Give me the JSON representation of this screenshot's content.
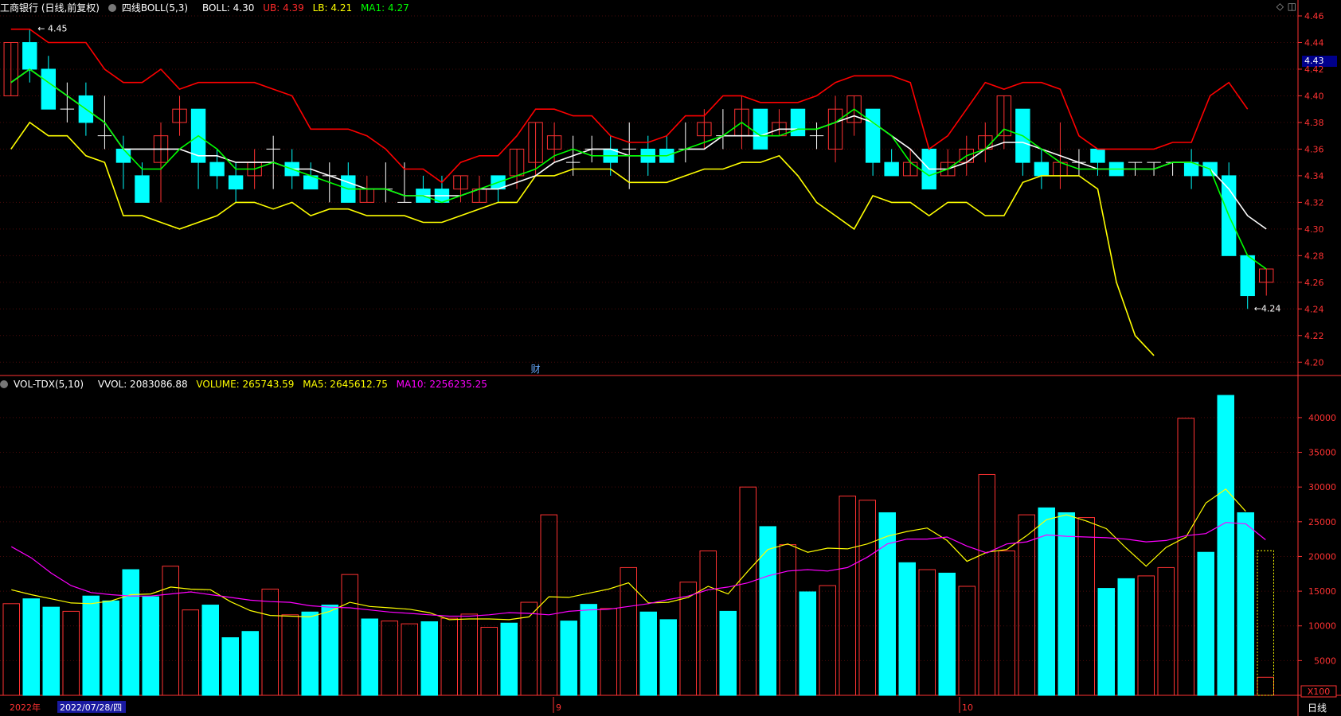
{
  "title": "工商银行 (日线,前复权)",
  "boll": {
    "name": "四线BOLL(5,3)",
    "items": [
      {
        "label": "BOLL: 4.30",
        "color": "#ffffff"
      },
      {
        "label": "UB: 4.39",
        "color": "#ff2a2a"
      },
      {
        "label": "LB: 4.21",
        "color": "#ffff00"
      },
      {
        "label": "MA1: 4.27",
        "color": "#00ff00"
      }
    ]
  },
  "vol": {
    "name": "VOL-TDX(5,10)",
    "items": [
      {
        "label": "VVOL: 2083086.88",
        "color": "#ffffff"
      },
      {
        "label": "VOLUME: 265743.59",
        "color": "#ffff00"
      },
      {
        "label": "MA5: 2645612.75",
        "color": "#ffff00"
      },
      {
        "label": "MA10: 2256235.25",
        "color": "#ff00ff"
      }
    ]
  },
  "current_price": "4.43",
  "marker_fin": "财",
  "max_label": "4.45",
  "min_label": "4.24",
  "vol_unit": "X100",
  "period_label": "日线",
  "dates": {
    "year": "2022年",
    "cursor": "2022/07/28/四",
    "m9": "9",
    "m10": "10"
  },
  "colors": {
    "up": "#ff3232",
    "down": "#00ffff",
    "ub": "#ff0000",
    "lb": "#ffff00",
    "mid": "#ffffff",
    "ma1": "#00ff00",
    "vma5": "#ffff00",
    "vma10": "#ff00ff",
    "axis": "#ff3232"
  },
  "chart_data": [
    {
      "type": "candlestick",
      "ylim": [
        4.19,
        4.46
      ],
      "y_ticks": [
        "4.20",
        "4.22",
        "4.24",
        "4.26",
        "4.28",
        "4.30",
        "4.32",
        "4.34",
        "4.36",
        "4.38",
        "4.40",
        "4.42",
        "4.44",
        "4.46"
      ],
      "candles": [
        {
          "o": 4.4,
          "c": 4.44,
          "h": 4.44,
          "l": 4.4
        },
        {
          "o": 4.44,
          "c": 4.42,
          "h": 4.45,
          "l": 4.41
        },
        {
          "o": 4.42,
          "c": 4.39,
          "h": 4.43,
          "l": 4.39
        },
        {
          "o": 4.39,
          "c": 4.39,
          "h": 4.41,
          "l": 4.38
        },
        {
          "o": 4.4,
          "c": 4.38,
          "h": 4.41,
          "l": 4.37
        },
        {
          "o": 4.37,
          "c": 4.37,
          "h": 4.4,
          "l": 4.36
        },
        {
          "o": 4.36,
          "c": 4.35,
          "h": 4.37,
          "l": 4.33
        },
        {
          "o": 4.34,
          "c": 4.32,
          "h": 4.35,
          "l": 4.32
        },
        {
          "o": 4.35,
          "c": 4.37,
          "h": 4.38,
          "l": 4.32
        },
        {
          "o": 4.38,
          "c": 4.39,
          "h": 4.4,
          "l": 4.37
        },
        {
          "o": 4.39,
          "c": 4.35,
          "h": 4.39,
          "l": 4.33
        },
        {
          "o": 4.35,
          "c": 4.34,
          "h": 4.36,
          "l": 4.33
        },
        {
          "o": 4.34,
          "c": 4.33,
          "h": 4.35,
          "l": 4.32
        },
        {
          "o": 4.34,
          "c": 4.35,
          "h": 4.36,
          "l": 4.33
        },
        {
          "o": 4.36,
          "c": 4.36,
          "h": 4.37,
          "l": 4.33
        },
        {
          "o": 4.35,
          "c": 4.34,
          "h": 4.36,
          "l": 4.33
        },
        {
          "o": 4.34,
          "c": 4.33,
          "h": 4.35,
          "l": 4.33
        },
        {
          "o": 4.34,
          "c": 4.34,
          "h": 4.35,
          "l": 4.32
        },
        {
          "o": 4.34,
          "c": 4.32,
          "h": 4.35,
          "l": 4.32
        },
        {
          "o": 4.32,
          "c": 4.33,
          "h": 4.34,
          "l": 4.32
        },
        {
          "o": 4.33,
          "c": 4.33,
          "h": 4.35,
          "l": 4.32
        },
        {
          "o": 4.32,
          "c": 4.32,
          "h": 4.35,
          "l": 4.32
        },
        {
          "o": 4.33,
          "c": 4.32,
          "h": 4.34,
          "l": 4.32
        },
        {
          "o": 4.33,
          "c": 4.32,
          "h": 4.34,
          "l": 4.32
        },
        {
          "o": 4.33,
          "c": 4.34,
          "h": 4.34,
          "l": 4.32
        },
        {
          "o": 4.32,
          "c": 4.33,
          "h": 4.34,
          "l": 4.32
        },
        {
          "o": 4.34,
          "c": 4.33,
          "h": 4.34,
          "l": 4.32
        },
        {
          "o": 4.34,
          "c": 4.36,
          "h": 4.36,
          "l": 4.33
        },
        {
          "o": 4.35,
          "c": 4.38,
          "h": 4.38,
          "l": 4.34
        },
        {
          "o": 4.36,
          "c": 4.37,
          "h": 4.38,
          "l": 4.35
        },
        {
          "o": 4.35,
          "c": 4.35,
          "h": 4.37,
          "l": 4.34
        },
        {
          "o": 4.36,
          "c": 4.36,
          "h": 4.37,
          "l": 4.35
        },
        {
          "o": 4.36,
          "c": 4.35,
          "h": 4.37,
          "l": 4.34
        },
        {
          "o": 4.36,
          "c": 4.36,
          "h": 4.38,
          "l": 4.33
        },
        {
          "o": 4.36,
          "c": 4.35,
          "h": 4.37,
          "l": 4.34
        },
        {
          "o": 4.36,
          "c": 4.35,
          "h": 4.37,
          "l": 4.35
        },
        {
          "o": 4.36,
          "c": 4.36,
          "h": 4.38,
          "l": 4.35
        },
        {
          "o": 4.37,
          "c": 4.38,
          "h": 4.39,
          "l": 4.36
        },
        {
          "o": 4.37,
          "c": 4.37,
          "h": 4.39,
          "l": 4.36
        },
        {
          "o": 4.37,
          "c": 4.39,
          "h": 4.4,
          "l": 4.36
        },
        {
          "o": 4.39,
          "c": 4.36,
          "h": 4.39,
          "l": 4.36
        },
        {
          "o": 4.37,
          "c": 4.38,
          "h": 4.39,
          "l": 4.37
        },
        {
          "o": 4.39,
          "c": 4.37,
          "h": 4.39,
          "l": 4.37
        },
        {
          "o": 4.37,
          "c": 4.37,
          "h": 4.38,
          "l": 4.36
        },
        {
          "o": 4.36,
          "c": 4.39,
          "h": 4.4,
          "l": 4.35
        },
        {
          "o": 4.38,
          "c": 4.4,
          "h": 4.4,
          "l": 4.37
        },
        {
          "o": 4.39,
          "c": 4.35,
          "h": 4.39,
          "l": 4.34
        },
        {
          "o": 4.35,
          "c": 4.34,
          "h": 4.36,
          "l": 4.34
        },
        {
          "o": 4.34,
          "c": 4.35,
          "h": 4.36,
          "l": 4.34
        },
        {
          "o": 4.36,
          "c": 4.33,
          "h": 4.36,
          "l": 4.33
        },
        {
          "o": 4.34,
          "c": 4.35,
          "h": 4.36,
          "l": 4.34
        },
        {
          "o": 4.35,
          "c": 4.36,
          "h": 4.37,
          "l": 4.34
        },
        {
          "o": 4.36,
          "c": 4.37,
          "h": 4.38,
          "l": 4.35
        },
        {
          "o": 4.37,
          "c": 4.4,
          "h": 4.4,
          "l": 4.36
        },
        {
          "o": 4.39,
          "c": 4.35,
          "h": 4.39,
          "l": 4.34
        },
        {
          "o": 4.35,
          "c": 4.34,
          "h": 4.36,
          "l": 4.33
        },
        {
          "o": 4.34,
          "c": 4.35,
          "h": 4.38,
          "l": 4.33
        },
        {
          "o": 4.35,
          "c": 4.35,
          "h": 4.36,
          "l": 4.34
        },
        {
          "o": 4.36,
          "c": 4.35,
          "h": 4.36,
          "l": 4.34
        },
        {
          "o": 4.35,
          "c": 4.34,
          "h": 4.35,
          "l": 4.34
        },
        {
          "o": 4.35,
          "c": 4.35,
          "h": 4.35,
          "l": 4.34
        },
        {
          "o": 4.35,
          "c": 4.35,
          "h": 4.35,
          "l": 4.34
        },
        {
          "o": 4.35,
          "c": 4.35,
          "h": 4.35,
          "l": 4.34
        },
        {
          "o": 4.35,
          "c": 4.34,
          "h": 4.36,
          "l": 4.33
        },
        {
          "o": 4.35,
          "c": 4.34,
          "h": 4.35,
          "l": 4.34
        },
        {
          "o": 4.34,
          "c": 4.28,
          "h": 4.35,
          "l": 4.28
        },
        {
          "o": 4.28,
          "c": 4.25,
          "h": 4.28,
          "l": 4.24
        },
        {
          "o": 4.26,
          "c": 4.27,
          "h": 4.27,
          "l": 4.25
        }
      ],
      "mid": [
        4.41,
        4.42,
        4.41,
        4.4,
        4.39,
        4.38,
        4.36,
        4.36,
        4.36,
        4.36,
        4.355,
        4.355,
        4.35,
        4.35,
        4.35,
        4.345,
        4.345,
        4.34,
        4.335,
        4.33,
        4.33,
        4.325,
        4.325,
        4.325,
        4.325,
        4.33,
        4.33,
        4.335,
        4.34,
        4.35,
        4.355,
        4.36,
        4.36,
        4.355,
        4.355,
        4.355,
        4.36,
        4.36,
        4.37,
        4.37,
        4.37,
        4.375,
        4.375,
        4.375,
        4.38,
        4.385,
        4.38,
        4.37,
        4.36,
        4.345,
        4.345,
        4.35,
        4.36,
        4.365,
        4.365,
        4.36,
        4.355,
        4.35,
        4.345,
        4.345,
        4.345,
        4.345,
        4.35,
        4.35,
        4.345,
        4.33,
        4.31,
        4.3
      ],
      "ub": [
        4.45,
        4.45,
        4.44,
        4.44,
        4.44,
        4.42,
        4.41,
        4.41,
        4.42,
        4.405,
        4.41,
        4.41,
        4.41,
        4.41,
        4.405,
        4.4,
        4.375,
        4.375,
        4.375,
        4.37,
        4.36,
        4.345,
        4.345,
        4.335,
        4.35,
        4.355,
        4.355,
        4.37,
        4.39,
        4.39,
        4.385,
        4.385,
        4.37,
        4.365,
        4.365,
        4.37,
        4.385,
        4.385,
        4.4,
        4.4,
        4.395,
        4.395,
        4.395,
        4.4,
        4.41,
        4.415,
        4.415,
        4.415,
        4.41,
        4.36,
        4.37,
        4.39,
        4.41,
        4.405,
        4.41,
        4.41,
        4.405,
        4.37,
        4.36,
        4.36,
        4.36,
        4.36,
        4.365,
        4.365,
        4.4,
        4.41,
        4.39
      ],
      "lb": [
        4.36,
        4.38,
        4.37,
        4.37,
        4.355,
        4.35,
        4.31,
        4.31,
        4.305,
        4.3,
        4.305,
        4.31,
        4.32,
        4.32,
        4.315,
        4.32,
        4.31,
        4.315,
        4.315,
        4.31,
        4.31,
        4.31,
        4.305,
        4.305,
        4.31,
        4.315,
        4.32,
        4.32,
        4.34,
        4.34,
        4.345,
        4.345,
        4.345,
        4.335,
        4.335,
        4.335,
        4.34,
        4.345,
        4.345,
        4.35,
        4.35,
        4.355,
        4.34,
        4.32,
        4.31,
        4.3,
        4.325,
        4.32,
        4.32,
        4.31,
        4.32,
        4.32,
        4.31,
        4.31,
        4.335,
        4.34,
        4.34,
        4.34,
        4.33,
        4.26,
        4.22,
        4.205
      ],
      "ma1": [
        4.41,
        4.42,
        4.41,
        4.4,
        4.39,
        4.38,
        4.36,
        4.345,
        4.345,
        4.36,
        4.37,
        4.36,
        4.345,
        4.345,
        4.35,
        4.345,
        4.34,
        4.335,
        4.33,
        4.33,
        4.33,
        4.325,
        4.325,
        4.32,
        4.325,
        4.33,
        4.335,
        4.34,
        4.345,
        4.355,
        4.36,
        4.355,
        4.355,
        4.355,
        4.355,
        4.355,
        4.36,
        4.365,
        4.37,
        4.38,
        4.37,
        4.37,
        4.375,
        4.375,
        4.38,
        4.39,
        4.38,
        4.37,
        4.35,
        4.34,
        4.345,
        4.355,
        4.36,
        4.375,
        4.37,
        4.36,
        4.35,
        4.345,
        4.345,
        4.345,
        4.345,
        4.345,
        4.35,
        4.35,
        4.345,
        4.31,
        4.28,
        4.27
      ]
    },
    {
      "type": "bar",
      "ylim": [
        0,
        44000
      ],
      "y_ticks": [
        "5000",
        "10000",
        "15000",
        "20000",
        "25000",
        "30000",
        "35000",
        "40000"
      ],
      "values": [
        13200,
        13900,
        12700,
        12100,
        14300,
        13600,
        18100,
        14200,
        18600,
        12300,
        13000,
        8300,
        9200,
        15300,
        11600,
        12000,
        13000,
        17400,
        11000,
        10700,
        10300,
        10600,
        11100,
        11700,
        9800,
        10400,
        13400,
        26000,
        10700,
        13100,
        12500,
        18400,
        12000,
        10900,
        16300,
        20800,
        12100,
        30000,
        24300,
        21700,
        14900,
        15800,
        28700,
        28100,
        26300,
        19100,
        18100,
        17600,
        15700,
        31800,
        20800,
        26000,
        27000,
        26300,
        25600,
        15400,
        16800,
        17200,
        18400,
        39900,
        20600,
        43200,
        26300,
        2600
      ],
      "up": [
        1,
        0,
        0,
        1,
        0,
        0,
        0,
        0,
        1,
        1,
        0,
        0,
        0,
        1,
        1,
        0,
        0,
        1,
        0,
        1,
        1,
        0,
        1,
        1,
        1,
        0,
        1,
        1,
        0,
        0,
        1,
        1,
        0,
        0,
        1,
        1,
        0,
        1,
        0,
        1,
        0,
        1,
        1,
        1,
        0,
        0,
        1,
        0,
        1,
        1,
        1,
        1,
        0,
        0,
        1,
        0,
        0,
        1,
        1,
        1,
        0,
        0,
        0,
        1
      ],
      "ma5": [
        15200,
        14500,
        13900,
        13300,
        13200,
        13600,
        14500,
        14600,
        15600,
        15300,
        15200,
        13500,
        12200,
        11500,
        11400,
        11300,
        12100,
        13400,
        12800,
        12600,
        12400,
        11900,
        10900,
        11000,
        11000,
        10900,
        11300,
        14200,
        14100,
        14700,
        15300,
        16200,
        13300,
        13400,
        14100,
        15700,
        14600,
        17900,
        21000,
        21800,
        20600,
        21200,
        21100,
        21800,
        22900,
        23600,
        24100,
        22300,
        19300,
        20600,
        21000,
        23000,
        25300,
        26000,
        25100,
        24000,
        21200,
        18600,
        21300,
        22800,
        27700,
        29700,
        26500
      ],
      "ma10": [
        21400,
        19800,
        17600,
        15800,
        14800,
        14500,
        14300,
        14300,
        14600,
        14900,
        14500,
        14100,
        13700,
        13500,
        13400,
        12900,
        12700,
        12600,
        12300,
        12000,
        11800,
        11600,
        11400,
        11400,
        11600,
        11900,
        11800,
        11600,
        12100,
        12300,
        12400,
        12800,
        13200,
        13800,
        14300,
        15200,
        15600,
        16200,
        17200,
        17900,
        18100,
        17900,
        18400,
        19900,
        21800,
        22500,
        22500,
        22800,
        21500,
        20500,
        21800,
        22100,
        23100,
        22900,
        22800,
        22700,
        22500,
        22100,
        22300,
        23000,
        23300,
        24900,
        24700,
        22400
      ]
    }
  ]
}
